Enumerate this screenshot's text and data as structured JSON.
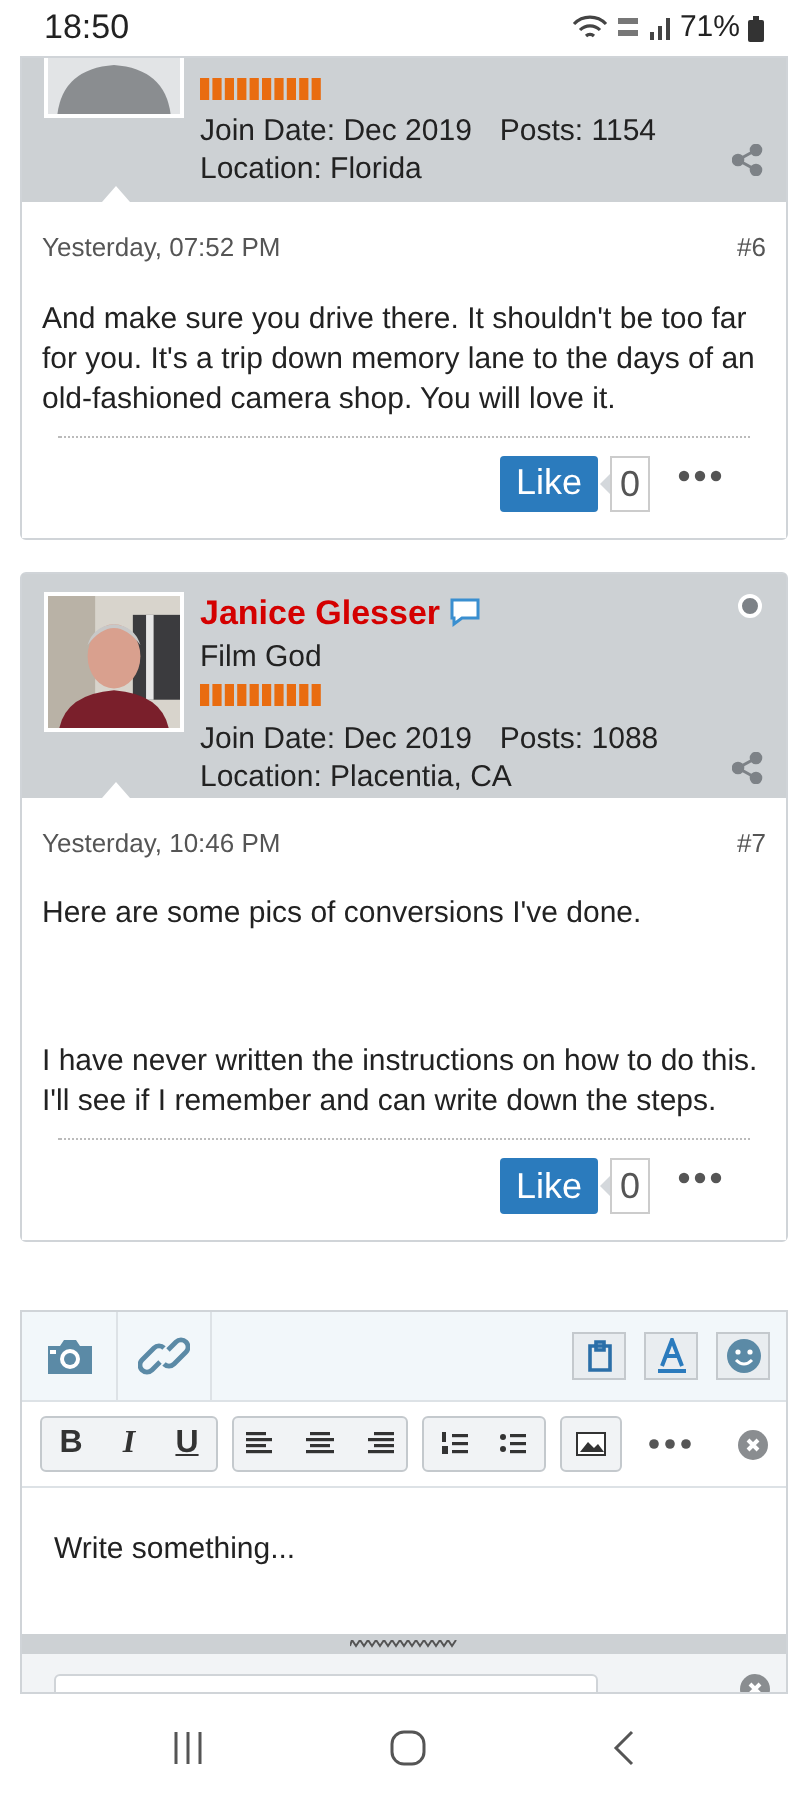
{
  "status_bar": {
    "time": "18:50",
    "battery": "71%"
  },
  "posts": [
    {
      "avatar": {
        "kind": "placeholder"
      },
      "join_date": "Join Date: Dec 2019",
      "post_count": "Posts: 1154",
      "location": "Location: Florida",
      "time": "Yesterday, 07:52 PM",
      "number": "#6",
      "paragraphs": [
        "And make sure you drive there. It shouldn't be too far for you. It's a trip down memory lane to the days of an old-fashioned camera shop. You will love it."
      ],
      "like": "Like",
      "like_count": "0"
    },
    {
      "avatar": {
        "kind": "picture"
      },
      "username": "Janice Glesser",
      "user_title": "Film God",
      "online": false,
      "join_date": "Join Date: Dec 2019",
      "post_count": "Posts: 1088",
      "location": "Location: Placentia, CA",
      "time": "Yesterday, 10:46 PM",
      "number": "#7",
      "paragraphs": [
        "Here are some pics of conversions I've done.",
        "I have never written the instructions on how to do this. I'll see if I remember and can write down the steps."
      ],
      "like": "Like",
      "like_count": "0"
    }
  ],
  "editor": {
    "format_buttons": [
      [
        "B",
        "I",
        "U"
      ]
    ],
    "placeholder": "Write something..."
  }
}
